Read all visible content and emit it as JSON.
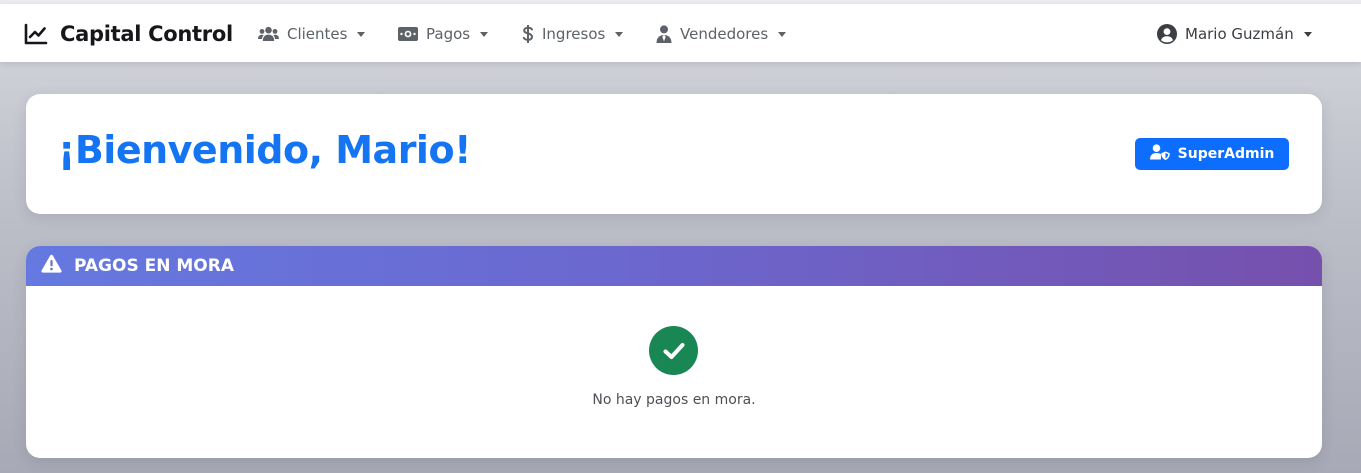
{
  "navbar": {
    "brand": "Capital Control",
    "items": [
      {
        "label": "Clientes",
        "icon": "users-icon"
      },
      {
        "label": "Pagos",
        "icon": "money-bill-icon"
      },
      {
        "label": "Ingresos",
        "icon": "dollar-icon"
      },
      {
        "label": "Vendedores",
        "icon": "user-tie-icon"
      }
    ],
    "user": {
      "name": "Mario Guzmán",
      "icon": "user-circle-icon"
    }
  },
  "welcome": {
    "title": "¡Bienvenido, Mario!",
    "role_badge": "SuperAdmin",
    "badge_icon": "user-shield-icon"
  },
  "mora": {
    "header": "PAGOS EN MORA",
    "header_icon": "warning-icon",
    "empty_icon": "check-circle-icon",
    "empty_message": "No hay pagos en mora."
  },
  "colors": {
    "accent": "#0d6efd",
    "title": "#1474f2",
    "success": "#198754",
    "header_gradient_start": "#6579e0",
    "header_gradient_end": "#7650ad"
  }
}
